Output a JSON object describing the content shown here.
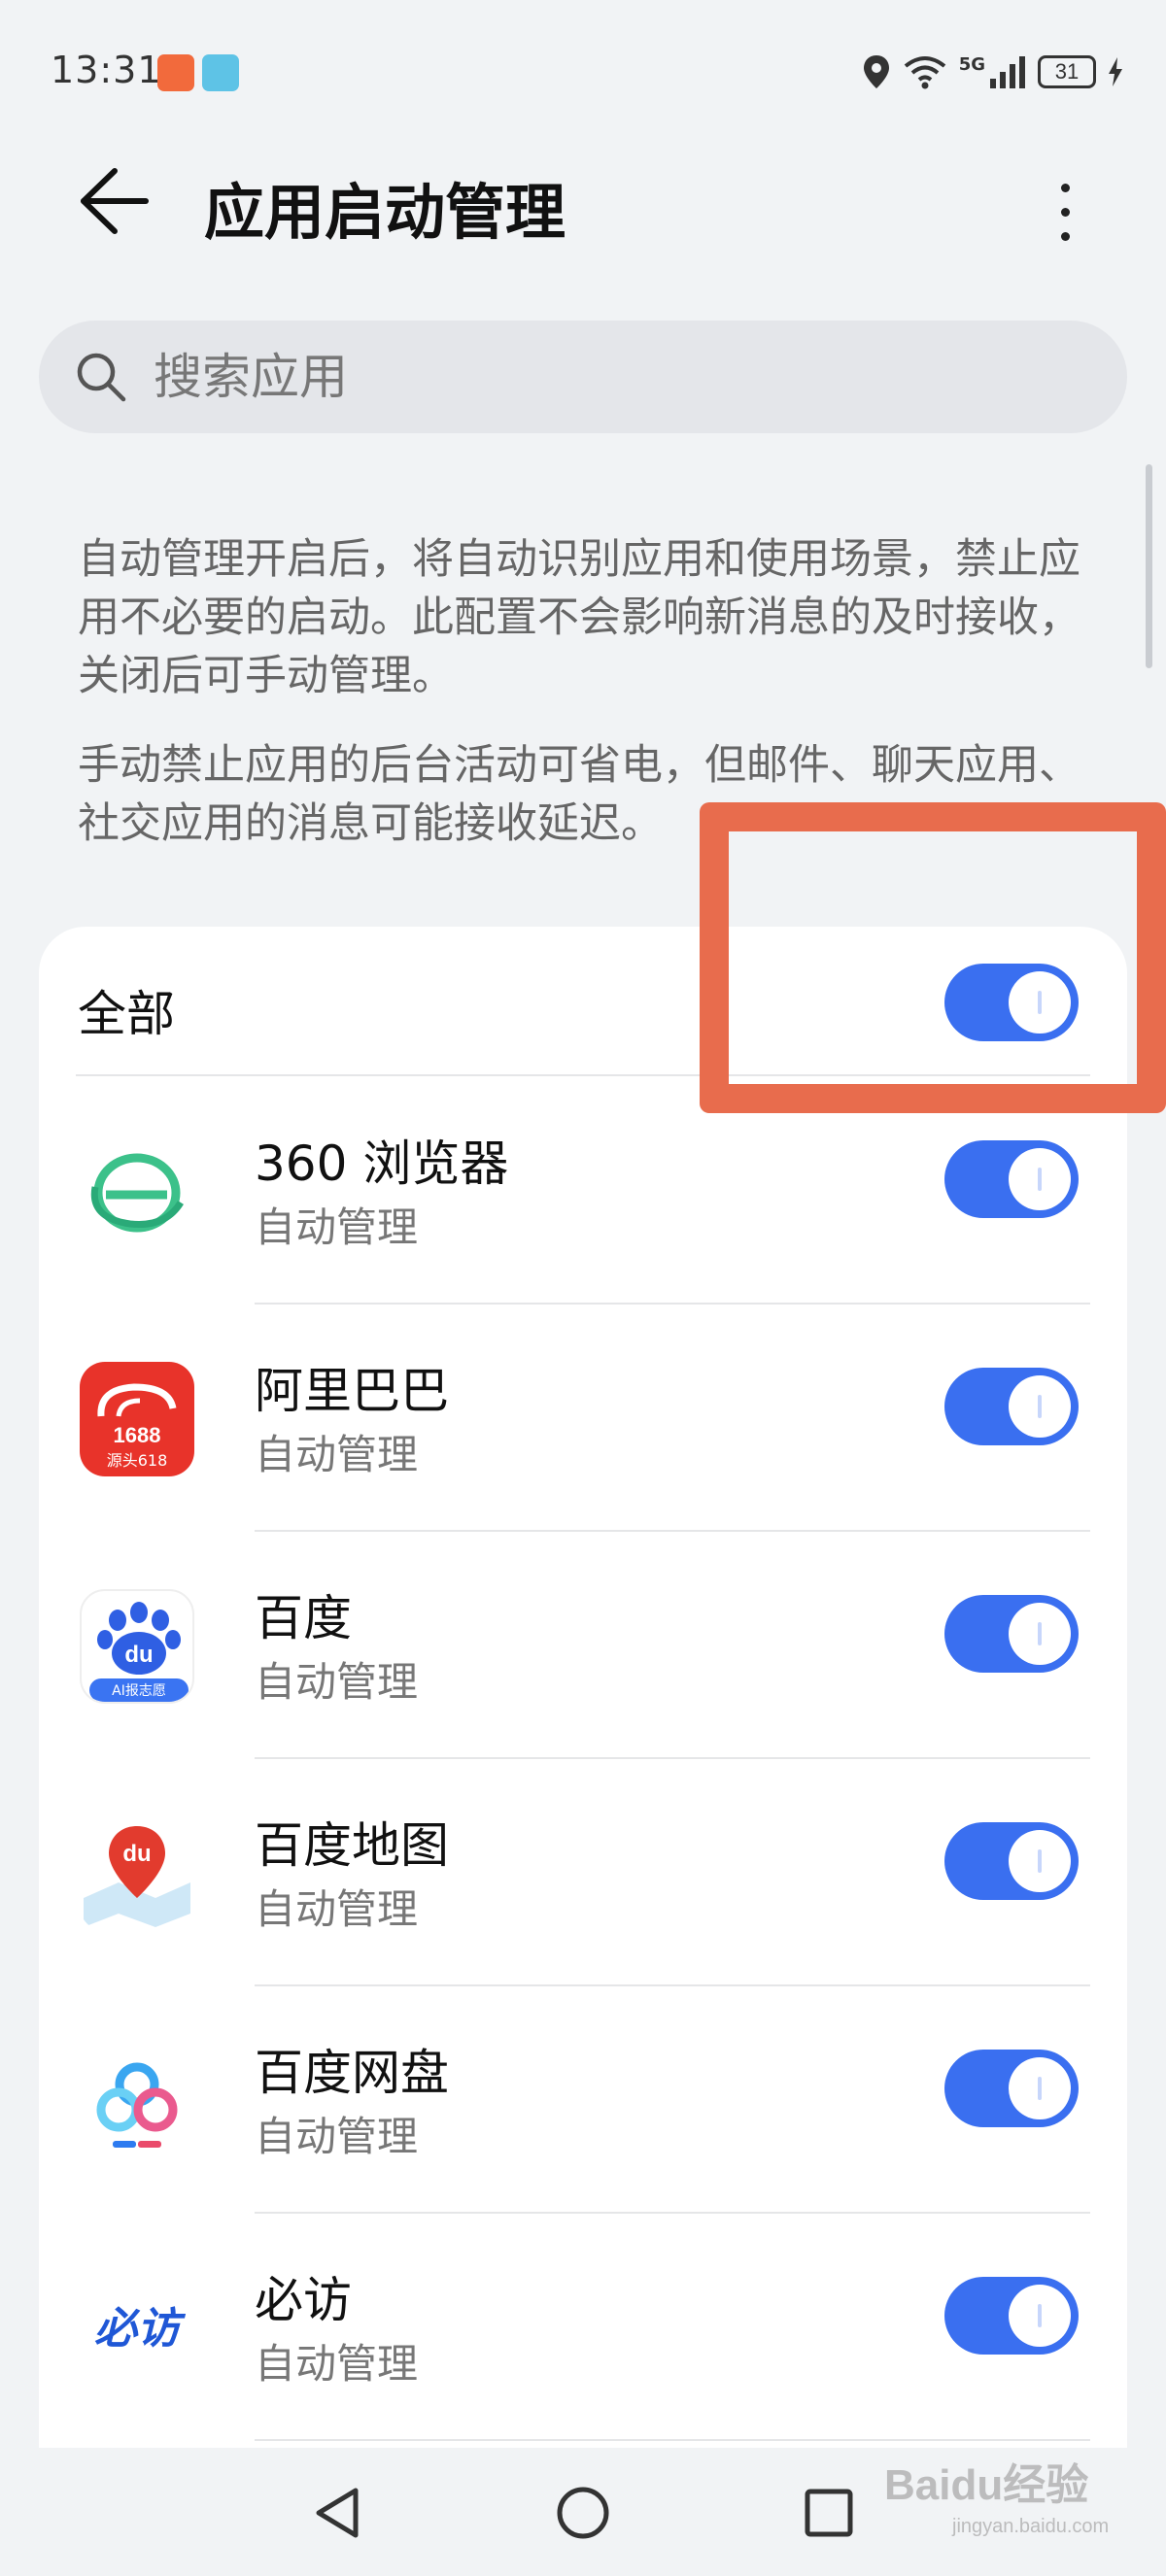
{
  "status": {
    "time": "13:31",
    "battery": "31",
    "network": "5G"
  },
  "header": {
    "title": "应用启动管理"
  },
  "search": {
    "placeholder": "搜索应用"
  },
  "description": {
    "paragraph1": "自动管理开启后，将自动识别应用和使用场景，禁止应用不必要的启动。此配置不会影响新消息的及时接收，关闭后可手动管理。",
    "paragraph2": "手动禁止应用的后台活动可省电，但邮件、聊天应用、社交应用的消息可能接收延迟。"
  },
  "all_toggle": {
    "label": "全部",
    "enabled": true
  },
  "apps": [
    {
      "name": "360 浏览器",
      "status": "自动管理",
      "enabled": true,
      "icon": "360-browser-icon"
    },
    {
      "name": "阿里巴巴",
      "status": "自动管理",
      "enabled": true,
      "icon": "alibaba-icon",
      "icon_text": "1688",
      "icon_caption": "源头618"
    },
    {
      "name": "百度",
      "status": "自动管理",
      "enabled": true,
      "icon": "baidu-icon",
      "icon_text": "du",
      "icon_caption": "AI报志愿"
    },
    {
      "name": "百度地图",
      "status": "自动管理",
      "enabled": true,
      "icon": "baidu-map-icon",
      "icon_text": "du"
    },
    {
      "name": "百度网盘",
      "status": "自动管理",
      "enabled": true,
      "icon": "baidu-netdisk-icon"
    },
    {
      "name": "必访",
      "status": "自动管理",
      "enabled": true,
      "icon": "bifang-icon",
      "icon_text": "必访"
    }
  ],
  "colors": {
    "accent": "#3a6ff0",
    "highlight": "#e86c4d",
    "background": "#f1f3f5"
  },
  "watermark": {
    "text": "Baidu经验",
    "subtext": "jingyan.baidu.com"
  }
}
